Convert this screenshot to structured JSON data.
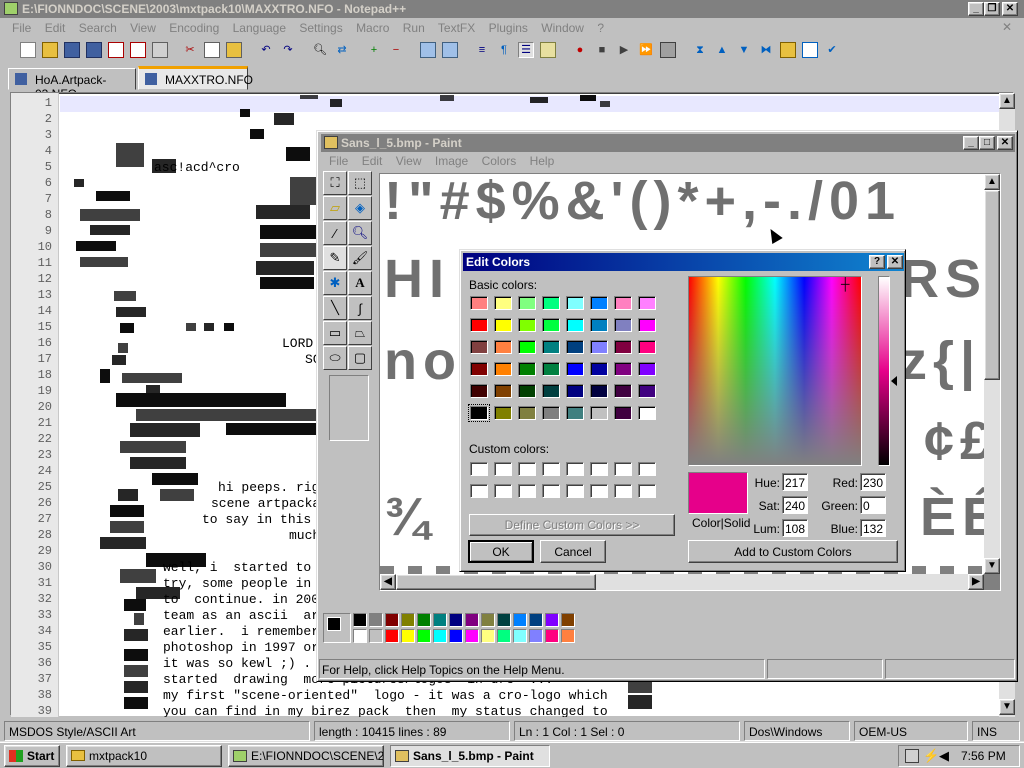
{
  "npp": {
    "title": "E:\\FIONNDOC\\SCENE\\2003\\mxtpack10\\MAXXTRO.NFO - Notepad++",
    "menu": [
      "File",
      "Edit",
      "Search",
      "View",
      "Encoding",
      "Language",
      "Settings",
      "Macro",
      "Run",
      "TextFX",
      "Plugins",
      "Window",
      "?"
    ],
    "tabs": [
      "HoA.Artpack-03.NFO",
      "MAXXTRO.NFO"
    ],
    "line_numbers": [
      "1",
      "2",
      "3",
      "4",
      "5",
      "6",
      "7",
      "8",
      "9",
      "10",
      "11",
      "12",
      "13",
      "14",
      "15",
      "16",
      "17",
      "18",
      "19",
      "20",
      "21",
      "22",
      "23",
      "24",
      "25",
      "26",
      "27",
      "28",
      "29",
      "30",
      "31",
      "32",
      "33",
      "34",
      "35",
      "36",
      "37",
      "38",
      "39"
    ],
    "text_lines": [
      {
        "text": "asc!acd^cro",
        "row": 5
      },
      {
        "text": "LORD",
        "row": 16
      },
      {
        "text": "SC",
        "row": 17
      },
      {
        "text": "hi peeps. rig",
        "row": 25
      },
      {
        "text": "scene artpacka",
        "row": 26
      },
      {
        "text": "to say in this",
        "row": 27
      },
      {
        "text": "much",
        "row": 28
      },
      {
        "text": "well, i  started to",
        "row": 30
      },
      {
        "text": "try, some people in",
        "row": 31
      },
      {
        "text": "to  continue. in 200",
        "row": 32
      },
      {
        "text": "team as an ascii  ar",
        "row": 33
      },
      {
        "text": "earlier.  i remember",
        "row": 34
      },
      {
        "text": "photoshop in 1997 or",
        "row": 35
      },
      {
        "text": "it was so kewl ;) .",
        "row": 36
      },
      {
        "text": "started  drawing  more pictures/logos  in dre  ...",
        "row": 37
      },
      {
        "text": "my first \"scene-oriented\"  logo - it was a cro-logo which",
        "row": 38
      },
      {
        "text": "you can find in my birez pack  then  my status changed to",
        "row": 39
      }
    ],
    "status": {
      "type": "MSDOS Style/ASCII Art",
      "length": "length : 10415   lines : 89",
      "pos": "Ln : 1   Col : 1   Sel : 0",
      "eol": "Dos\\Windows",
      "enc": "OEM-US",
      "mode": "INS"
    }
  },
  "paint": {
    "title": "Sans_l_5.bmp - Paint",
    "menu": [
      "File",
      "Edit",
      "View",
      "Image",
      "Colors",
      "Help"
    ],
    "status": "For Help, click Help Topics on the Help Menu.",
    "canvas_rows": [
      "!\"#$%&'()*+,-./01",
      "HI",
      "RST",
      "no",
      "z{|",
      "¢£",
      "¾",
      "ÈÉ"
    ],
    "palette": [
      "#000000",
      "#808080",
      "#800000",
      "#808000",
      "#008000",
      "#008080",
      "#000080",
      "#800080",
      "#808040",
      "#004040",
      "#0080ff",
      "#004080",
      "#8000ff",
      "#804000",
      "#ffffff",
      "#c0c0c0",
      "#ff0000",
      "#ffff00",
      "#00ff00",
      "#00ffff",
      "#0000ff",
      "#ff00ff",
      "#ffff80",
      "#00ff80",
      "#80ffff",
      "#8080ff",
      "#ff0080",
      "#ff8040"
    ]
  },
  "dialog": {
    "title": "Edit Colors",
    "basic_label": "Basic colors:",
    "custom_label": "Custom colors:",
    "define_label": "Define Custom Colors >>",
    "ok": "OK",
    "cancel": "Cancel",
    "add": "Add to Custom Colors",
    "color_solid": "Color|Solid",
    "basic_colors": [
      "#ff8080",
      "#ffff80",
      "#80ff80",
      "#00ff80",
      "#80ffff",
      "#0080ff",
      "#ff80c0",
      "#ff80ff",
      "#ff0000",
      "#ffff00",
      "#80ff00",
      "#00ff40",
      "#00ffff",
      "#0080c0",
      "#8080c0",
      "#ff00ff",
      "#804040",
      "#ff8040",
      "#00ff00",
      "#008080",
      "#004080",
      "#8080ff",
      "#800040",
      "#ff0080",
      "#800000",
      "#ff8000",
      "#008000",
      "#008040",
      "#0000ff",
      "#0000a0",
      "#800080",
      "#8000ff",
      "#400000",
      "#804000",
      "#004000",
      "#004040",
      "#000080",
      "#000040",
      "#400040",
      "#400080",
      "#000000",
      "#808000",
      "#808040",
      "#808080",
      "#408080",
      "#c0c0c0",
      "#400040",
      "#ffffff"
    ],
    "selected_color": "#e6008a",
    "fields": {
      "hue_label": "Hue:",
      "hue": "217",
      "sat_label": "Sat:",
      "sat": "240",
      "lum_label": "Lum:",
      "lum": "108",
      "red_label": "Red:",
      "red": "230",
      "green_label": "Green:",
      "green": "0",
      "blue_label": "Blue:",
      "blue": "132"
    }
  },
  "taskbar": {
    "start": "Start",
    "tasks": [
      "mxtpack10",
      "E:\\FIONNDOC\\SCENE\\2...",
      "Sans_l_5.bmp - Paint"
    ],
    "clock": "7:56 PM"
  }
}
